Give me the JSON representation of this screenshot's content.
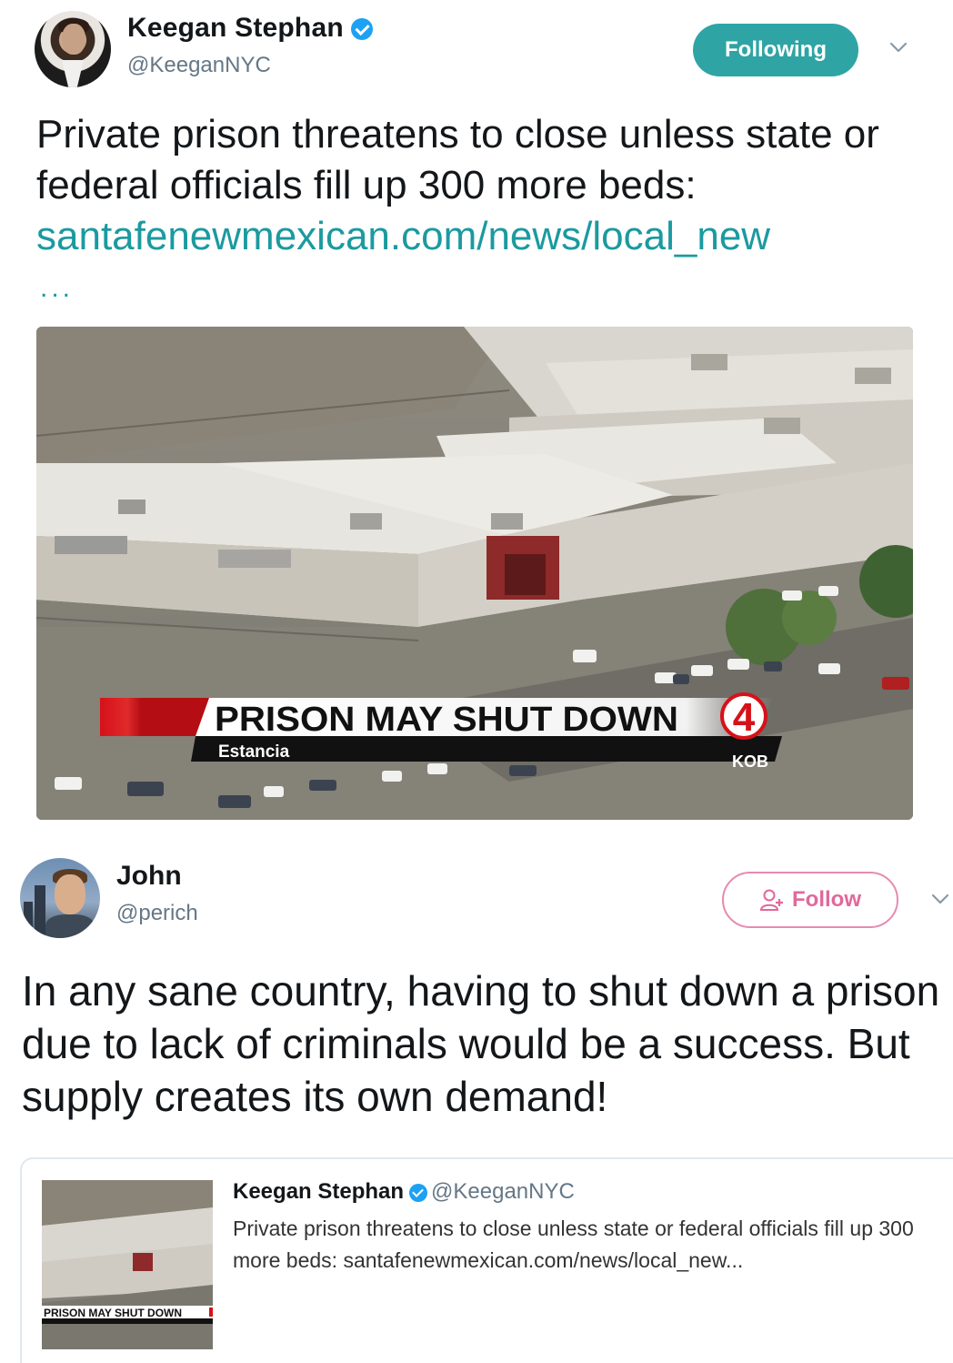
{
  "tweet": {
    "author": {
      "name": "Keegan Stephan",
      "handle": "@KeeganNYC",
      "verified": true
    },
    "follow_state_label": "Following",
    "text": "Private prison threatens to close unless state or federal officials fill up 300 more beds:",
    "link": "santafenewmexican.com/news/local_new",
    "link_ellipsis": "...",
    "media": {
      "headline": "PRISON MAY SHUT DOWN",
      "location": "Estancia",
      "station": "KOB",
      "channel_number": "4"
    }
  },
  "reply": {
    "author": {
      "name": "John",
      "handle": "@perich"
    },
    "follow_label": "Follow",
    "text": "In any sane country, having to shut down a prison due to lack of criminals would be a success. But supply creates its own demand!"
  },
  "quoted": {
    "author": {
      "name": "Keegan Stephan",
      "handle": "@KeeganNYC",
      "verified": true
    },
    "text": "Private prison threatens to close unless state or federal officials fill up 300 more beds: santafenewmexican.com/news/local_new...",
    "thumb_caption": "PRISON MAY SHUT DOWN"
  },
  "colors": {
    "following_button": "#2fa4a4",
    "link": "#1b9aa0",
    "follow_button_border": "#e58bb0",
    "follow_button_text": "#e0689c",
    "verified_badge": "#1da1f2",
    "handle_gray": "#657786",
    "banner_red": "#d6111a"
  },
  "icons": [
    "verified-badge-icon",
    "chevron-down-icon",
    "add-person-icon"
  ]
}
